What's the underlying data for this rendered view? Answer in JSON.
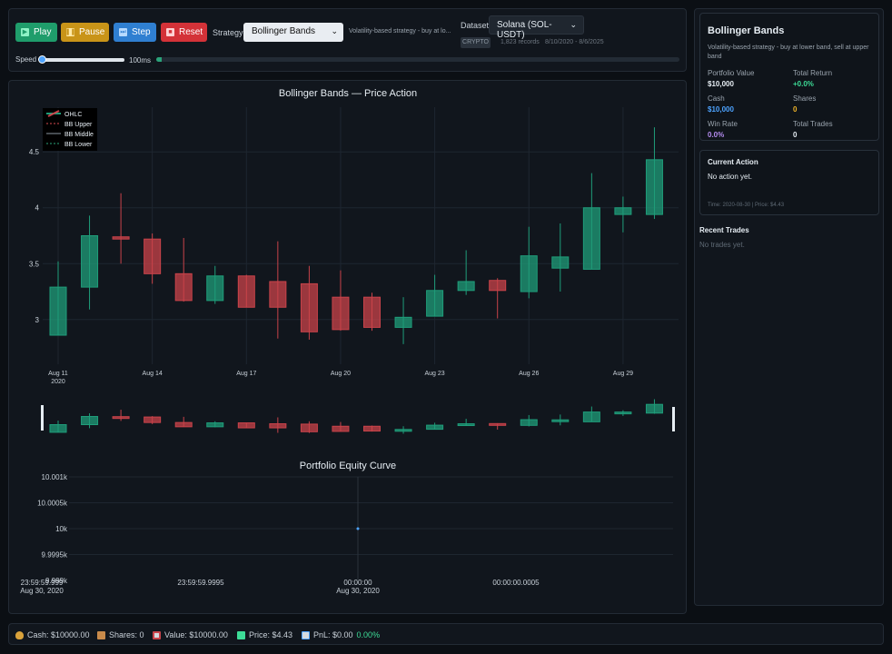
{
  "toolbar": {
    "play_label": "Play",
    "pause_label": "Pause",
    "step_label": "Step",
    "reset_label": "Reset",
    "strategy_label": "Strategy",
    "strategy_selected": "Bollinger Bands",
    "strategy_desc": "Volatility-based strategy - buy at lo...",
    "dataset_label": "Dataset",
    "dataset_selected": "Solana (SOL-USDT)",
    "crypto_badge": "CRYPTO",
    "records": "1,823 records",
    "date_range": "8/10/2020 - 8/6/2025",
    "speed_label": "Speed",
    "speed_value": "100ms",
    "speed_level": 0.0,
    "progress_fraction": 0.011
  },
  "chart_data": [
    {
      "type": "candlestick",
      "title": "Bollinger Bands — Price Action",
      "legend": [
        "OHLC",
        "BB Upper",
        "BB Middle",
        "BB Lower"
      ],
      "legend_position": "top-left",
      "x_ticks": [
        "Aug 11\n2020",
        "Aug 14",
        "Aug 17",
        "Aug 20",
        "Aug 23",
        "Aug 26",
        "Aug 29"
      ],
      "y_ticks": [
        3,
        3.5,
        4,
        4.5
      ],
      "ylim": [
        2.6,
        4.9
      ],
      "x": [
        "2020-08-11",
        "2020-08-12",
        "2020-08-13",
        "2020-08-14",
        "2020-08-15",
        "2020-08-16",
        "2020-08-17",
        "2020-08-18",
        "2020-08-19",
        "2020-08-20",
        "2020-08-21",
        "2020-08-22",
        "2020-08-23",
        "2020-08-24",
        "2020-08-25",
        "2020-08-26",
        "2020-08-27",
        "2020-08-28",
        "2020-08-29",
        "2020-08-30"
      ],
      "open": [
        2.86,
        3.29,
        3.74,
        3.72,
        3.41,
        3.17,
        3.39,
        3.34,
        3.32,
        3.2,
        3.2,
        2.93,
        3.03,
        3.26,
        3.35,
        3.25,
        3.46,
        3.45,
        3.94,
        3.94
      ],
      "high": [
        3.52,
        3.93,
        4.13,
        3.77,
        3.73,
        3.48,
        3.4,
        3.7,
        3.48,
        3.44,
        3.24,
        3.2,
        3.4,
        3.62,
        3.37,
        3.83,
        3.86,
        4.31,
        4.1,
        4.72
      ],
      "low": [
        2.86,
        3.09,
        3.5,
        3.32,
        3.16,
        3.14,
        3.11,
        2.83,
        2.82,
        2.9,
        2.9,
        2.78,
        3.03,
        3.22,
        3.01,
        3.19,
        3.25,
        3.45,
        3.78,
        3.9
      ],
      "close": [
        3.29,
        3.75,
        3.72,
        3.41,
        3.17,
        3.39,
        3.11,
        3.11,
        2.89,
        2.91,
        2.93,
        3.02,
        3.26,
        3.34,
        3.26,
        3.57,
        3.56,
        4.0,
        4.0,
        4.43
      ]
    },
    {
      "type": "line",
      "title": "Portfolio Equity Curve",
      "y_ticks": [
        "10.001k",
        "10.0005k",
        "10k",
        "9.9995k",
        "9.999k"
      ],
      "x_ticks": [
        "23:59:59.999\nAug 30, 2020",
        "23:59:59.9995",
        "00:00:00\nAug 30, 2020",
        "00:00:00.0005"
      ],
      "series": [
        {
          "values": [
            10000
          ]
        }
      ]
    }
  ],
  "mini_chart": {},
  "summary": {
    "title": "Bollinger Bands",
    "description": "Volatility-based strategy - buy at lower band, sell at upper band",
    "portfolio_value_label": "Portfolio Value",
    "portfolio_value": "$10,000",
    "total_return_label": "Total Return",
    "total_return": "+0.0%",
    "cash_label": "Cash",
    "cash": "$10,000",
    "shares_label": "Shares",
    "shares": "0",
    "win_rate_label": "Win Rate",
    "win_rate": "0.0%",
    "total_trades_label": "Total Trades",
    "total_trades": "0"
  },
  "current_action": {
    "title": "Current Action",
    "text": "No action yet.",
    "meta": "Time: 2020-08-30 | Price: $4.43"
  },
  "recent_trades": {
    "title": "Recent Trades",
    "empty": "No trades yet."
  },
  "status": {
    "cash": "Cash: $10000.00",
    "shares": "Shares: 0",
    "value": "Value: $10000.00",
    "price": "Price: $4.43",
    "pnl": "PnL: $0.00",
    "pnl_pct": "0.00%"
  },
  "colors": {
    "up": "#1f9d7a",
    "down": "#c9434a",
    "accent_green": "#3ddc97",
    "accent_yellow": "#f0b429",
    "accent_blue": "#4da3ff"
  }
}
